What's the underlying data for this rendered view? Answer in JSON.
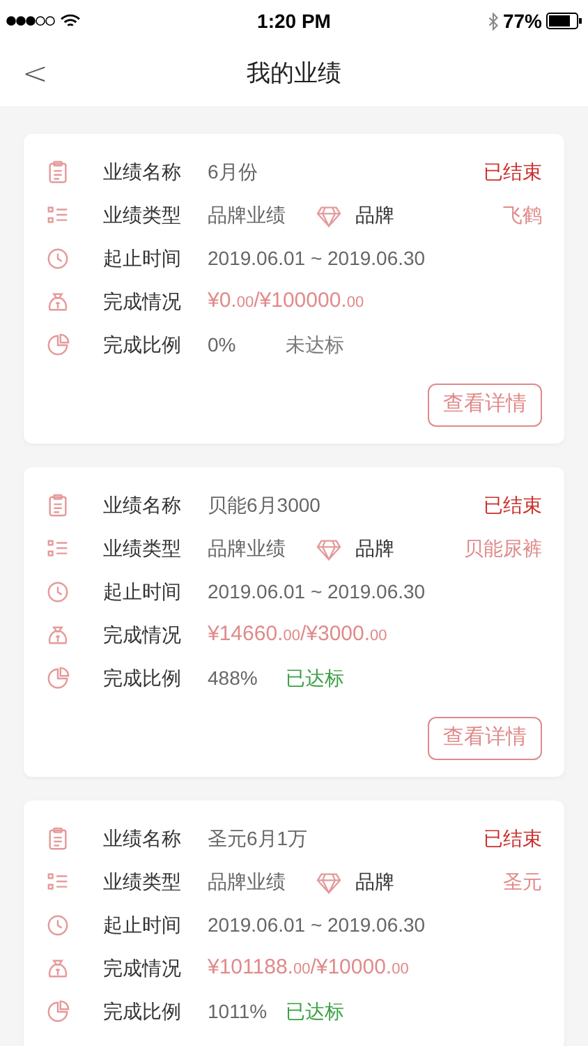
{
  "status_bar": {
    "time": "1:20 PM",
    "battery": "77%"
  },
  "nav": {
    "back": "<",
    "title": "我的业绩"
  },
  "cards": [
    {
      "name_label": "业绩名称",
      "name": "6月份",
      "status": "已结束",
      "type_label": "业绩类型",
      "type": "品牌业绩",
      "category": "品牌",
      "brand": "飞鹤",
      "period_label": "起止时间",
      "period": "2019.06.01 ~ 2019.06.30",
      "amount_label": "完成情况",
      "amount": [
        {
          "text": "¥0.",
          "small": false
        },
        {
          "text": "00",
          "small": true
        },
        {
          "text": "/¥100000.",
          "small": false
        },
        {
          "text": "00",
          "small": true
        }
      ],
      "ratio_label": "完成比例",
      "ratio": "0%",
      "result": "未达标",
      "reached": false,
      "button": "查看详情"
    },
    {
      "name_label": "业绩名称",
      "name": "贝能6月3000",
      "status": "已结束",
      "type_label": "业绩类型",
      "type": "品牌业绩",
      "category": "品牌",
      "brand": "贝能尿裤",
      "period_label": "起止时间",
      "period": "2019.06.01 ~ 2019.06.30",
      "amount_label": "完成情况",
      "amount": [
        {
          "text": "¥14660.",
          "small": false
        },
        {
          "text": "00",
          "small": true
        },
        {
          "text": "/¥3000.",
          "small": false
        },
        {
          "text": "00",
          "small": true
        }
      ],
      "ratio_label": "完成比例",
      "ratio": "488%",
      "result": "已达标",
      "reached": true,
      "button": "查看详情"
    },
    {
      "name_label": "业绩名称",
      "name": "圣元6月1万",
      "status": "已结束",
      "type_label": "业绩类型",
      "type": "品牌业绩",
      "category": "品牌",
      "brand": "圣元",
      "period_label": "起止时间",
      "period": "2019.06.01 ~ 2019.06.30",
      "amount_label": "完成情况",
      "amount": [
        {
          "text": "¥101188.",
          "small": false
        },
        {
          "text": "00",
          "small": true
        },
        {
          "text": "/¥10000.",
          "small": false
        },
        {
          "text": "00",
          "small": true
        }
      ],
      "ratio_label": "完成比例",
      "ratio": "1011%",
      "result": "已达标",
      "reached": true
    }
  ]
}
